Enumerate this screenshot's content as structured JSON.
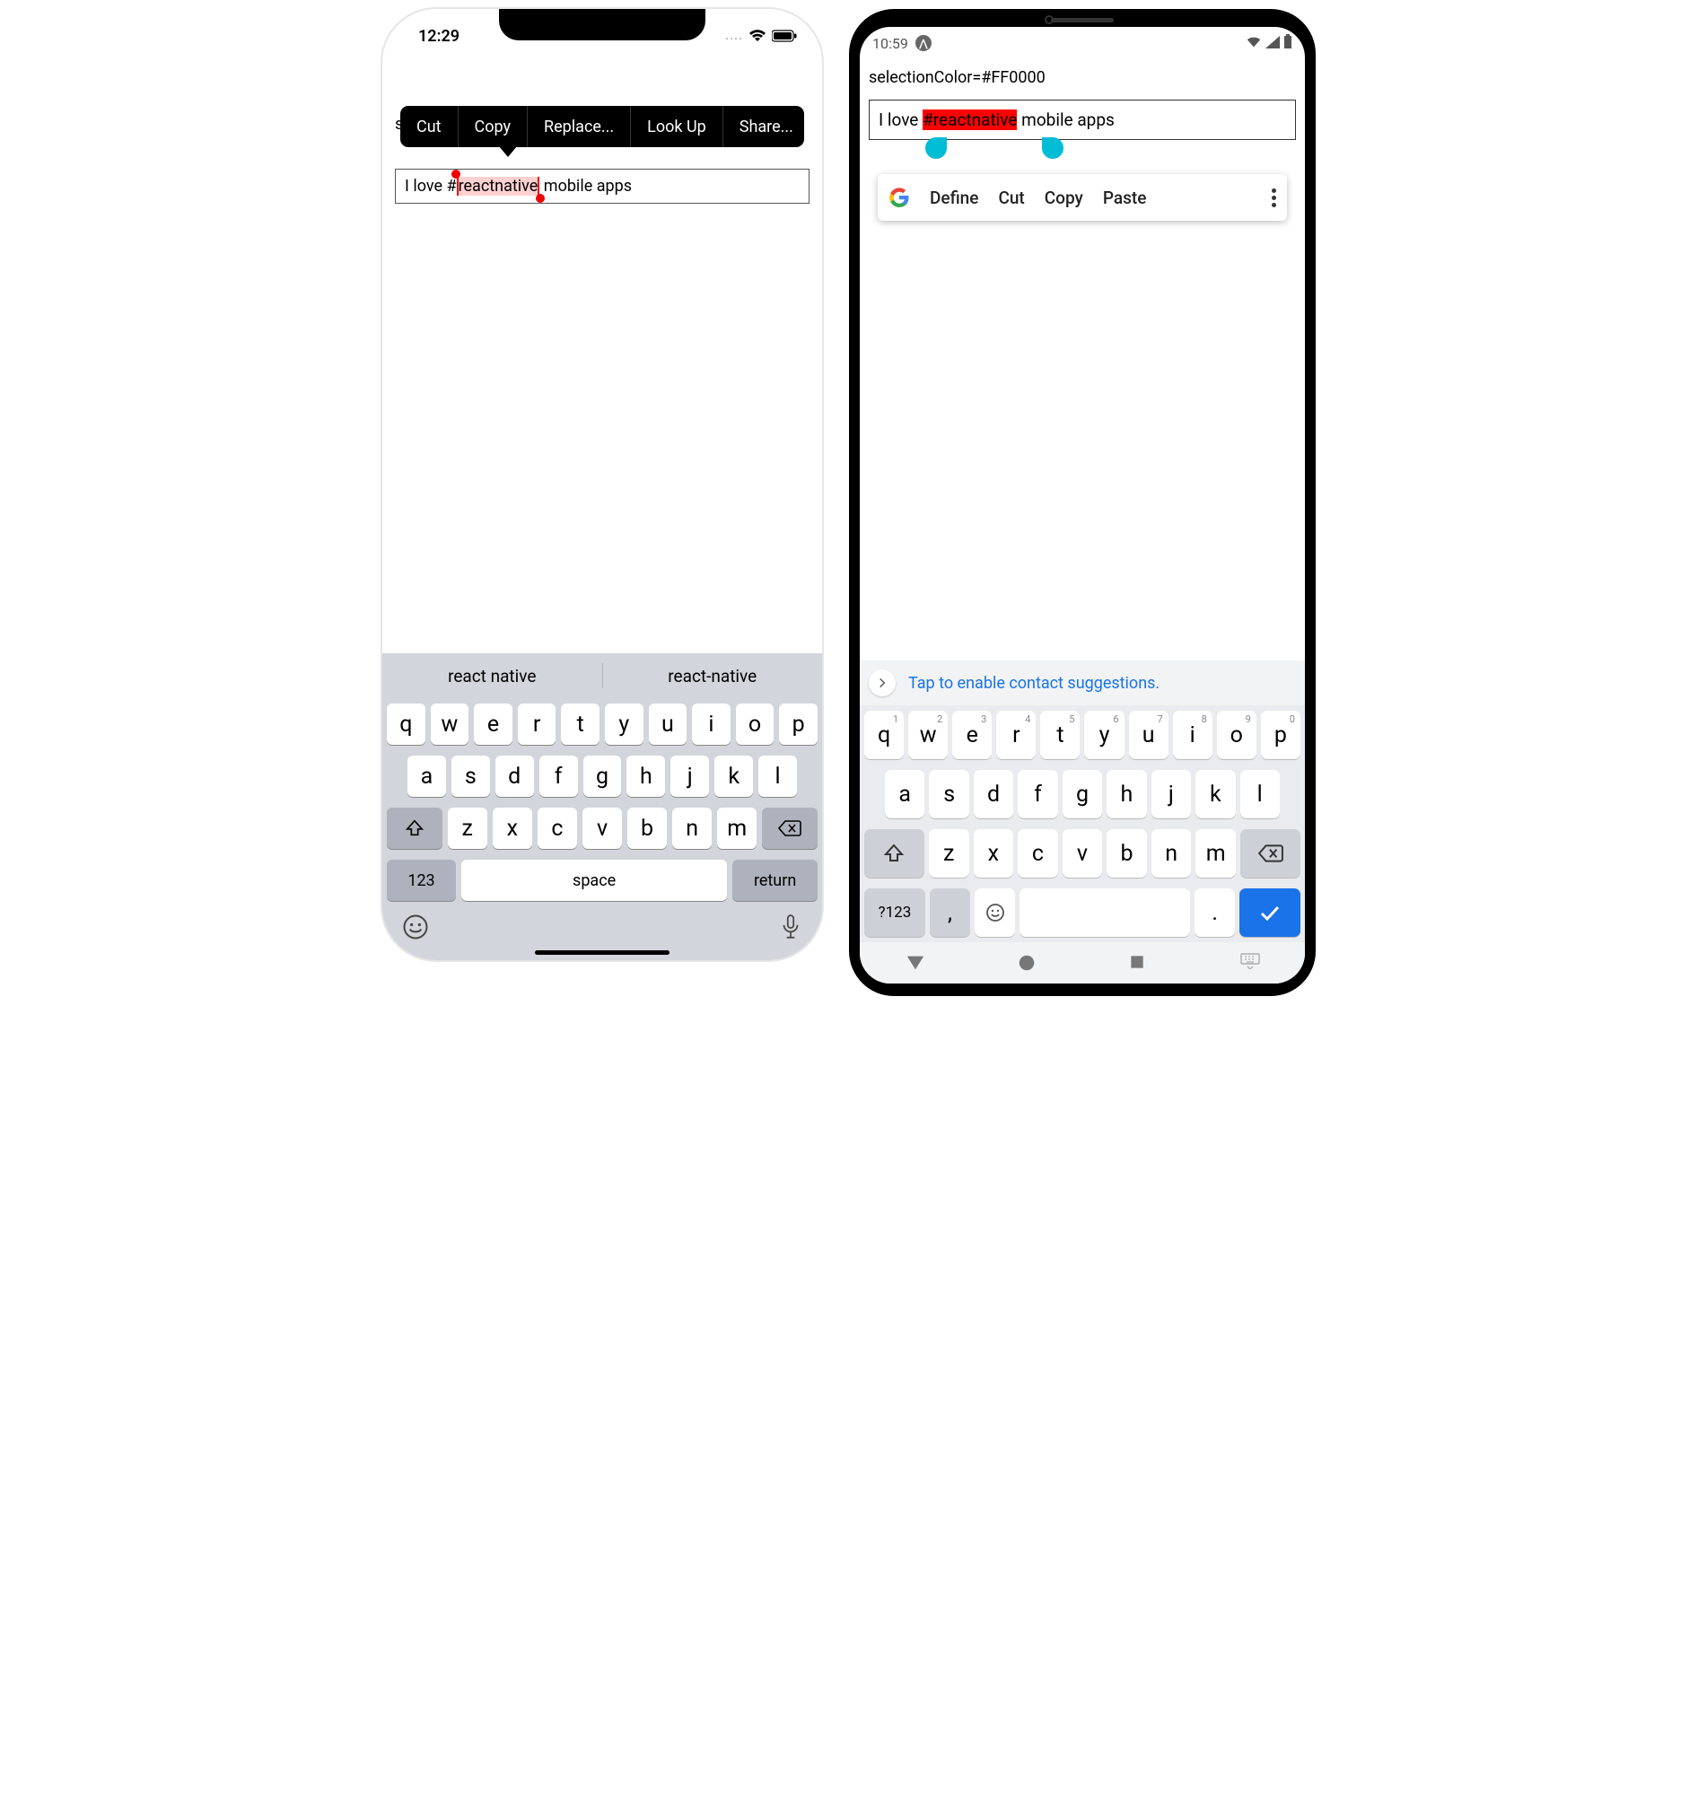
{
  "ios": {
    "status": {
      "time": "12:29",
      "dots": "...."
    },
    "label_truncated": "se",
    "context_menu": {
      "cut": "Cut",
      "copy": "Copy",
      "replace": "Replace...",
      "lookup": "Look Up",
      "share": "Share..."
    },
    "input": {
      "before": "I love #",
      "selected": "reactnative",
      "after": " mobile apps"
    },
    "suggestions": [
      "react native",
      "react-native"
    ],
    "keyboard": {
      "row1": [
        "q",
        "w",
        "e",
        "r",
        "t",
        "y",
        "u",
        "i",
        "o",
        "p"
      ],
      "row2": [
        "a",
        "s",
        "d",
        "f",
        "g",
        "h",
        "j",
        "k",
        "l"
      ],
      "row3": [
        "z",
        "x",
        "c",
        "v",
        "b",
        "n",
        "m"
      ],
      "numbers": "123",
      "space": "space",
      "return": "return"
    }
  },
  "android": {
    "status": {
      "time": "10:59"
    },
    "label": "selectionColor=#FF0000",
    "input": {
      "before": "I love ",
      "selected": "#reactnative",
      "after": " mobile apps"
    },
    "context_menu": {
      "define": "Define",
      "cut": "Cut",
      "copy": "Copy",
      "paste": "Paste"
    },
    "suggestion_bar": "Tap to enable contact suggestions.",
    "keyboard": {
      "row1": [
        [
          "q",
          "1"
        ],
        [
          "w",
          "2"
        ],
        [
          "e",
          "3"
        ],
        [
          "r",
          "4"
        ],
        [
          "t",
          "5"
        ],
        [
          "y",
          "6"
        ],
        [
          "u",
          "7"
        ],
        [
          "i",
          "8"
        ],
        [
          "o",
          "9"
        ],
        [
          "p",
          "0"
        ]
      ],
      "row2": [
        "a",
        "s",
        "d",
        "f",
        "g",
        "h",
        "j",
        "k",
        "l"
      ],
      "row3": [
        "z",
        "x",
        "c",
        "v",
        "b",
        "n",
        "m"
      ],
      "symbols": "?123",
      "comma": ",",
      "period": "."
    }
  }
}
